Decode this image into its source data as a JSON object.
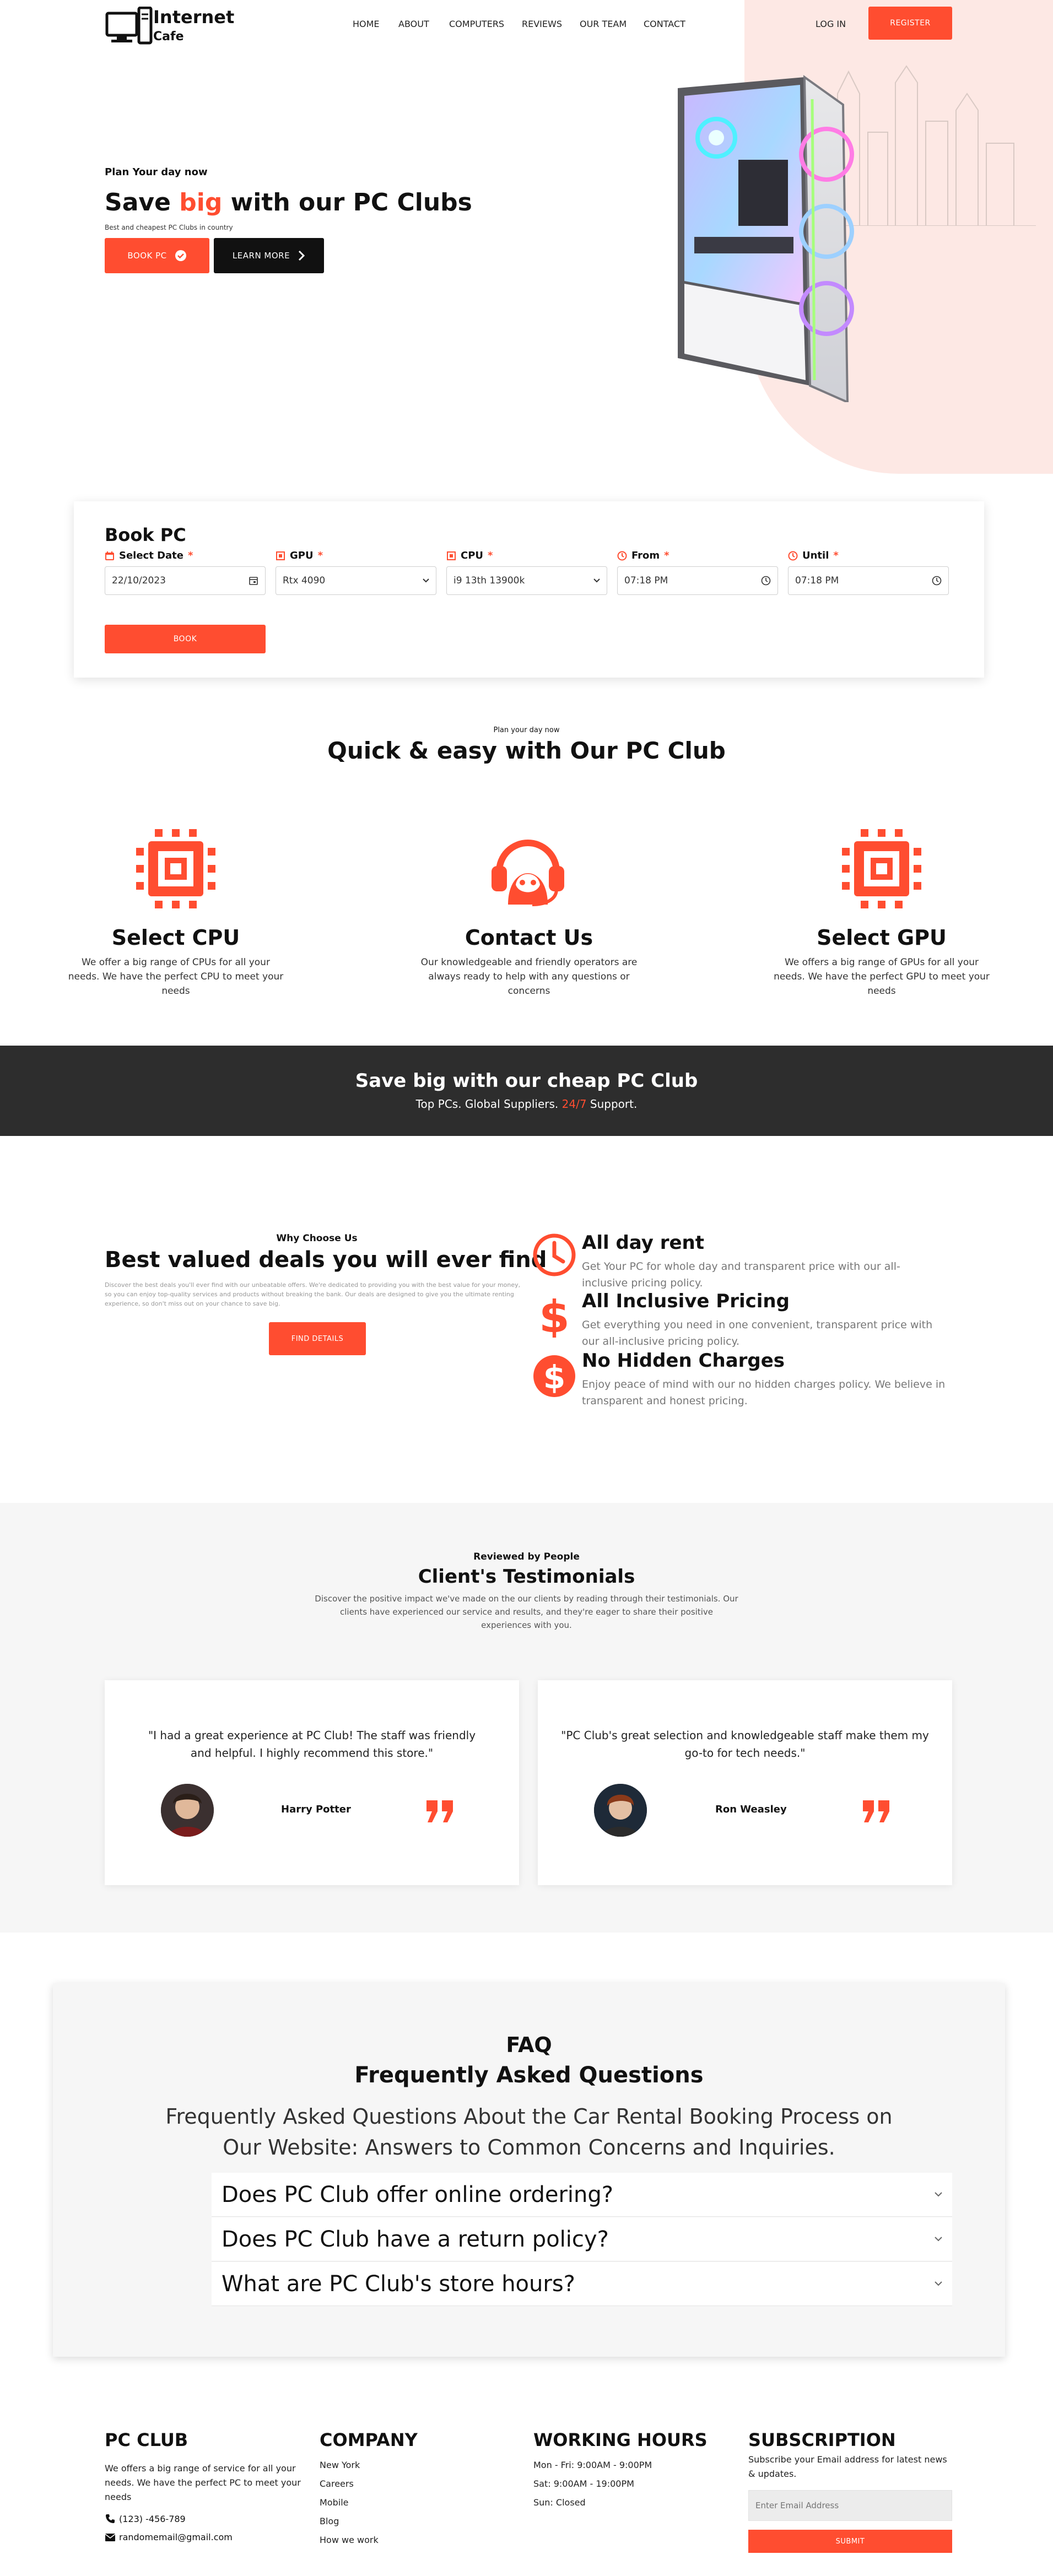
{
  "colors": {
    "accent": "#ff4d30",
    "dark_banner": "#2d2d2d",
    "hero_blob": "#fde8e4",
    "light_bg": "#f6f6f6"
  },
  "brand": {
    "line1": "Internet",
    "line2": "Cafe",
    "icon": "computer-icon"
  },
  "nav": {
    "links": [
      "HOME",
      "ABOUT",
      "COMPUTERS",
      "REVIEWS",
      "OUR TEAM",
      "CONTACT"
    ],
    "login": "LOG IN",
    "register": "REGISTER"
  },
  "hero": {
    "kicker": "Plan Your day now",
    "title_before": "Save ",
    "title_accent": "big",
    "title_after": " with our PC Clubs",
    "subtitle": "Best and cheapest PC Clubs in country",
    "book_button": "BOOK PC",
    "learn_button": "LEARN MORE"
  },
  "booking": {
    "title": "Book PC",
    "fields": [
      {
        "label": "Select Date",
        "value": "22/10/2023",
        "icon": "calendar-icon",
        "control": "calendar-icon"
      },
      {
        "label": "GPU",
        "value": "Rtx 4090",
        "icon": "chip-icon",
        "control": "chevron-down-icon"
      },
      {
        "label": "CPU",
        "value": "i9 13th 13900k",
        "icon": "chip-icon",
        "control": "chevron-down-icon"
      },
      {
        "label": "From",
        "value": "07:18 PM",
        "icon": "clock-icon",
        "control": "clock-icon"
      },
      {
        "label": "Until",
        "value": "07:18 PM",
        "icon": "clock-icon",
        "control": "clock-icon"
      }
    ],
    "required_mark": "*",
    "submit": "BOOK"
  },
  "features": {
    "kicker": "Plan your day now",
    "title": "Quick & easy with Our PC Club",
    "items": [
      {
        "title": "Select CPU",
        "desc": "We offer a big range of CPUs for all your needs. We have the perfect CPU to meet your needs",
        "icon": "cpu-icon"
      },
      {
        "title": "Contact Us",
        "desc": "Our knowledgeable and friendly operators are always ready to help with any questions or concerns",
        "icon": "headset-operator-icon"
      },
      {
        "title": "Select GPU",
        "desc": "We offers a big range of GPUs for all your needs. We have the perfect GPU to meet your needs",
        "icon": "cpu-icon"
      }
    ]
  },
  "banner": {
    "title": "Save big with our cheap PC Club",
    "sub_before": "Top PCs. Global Suppliers. ",
    "sub_accent": "24/7",
    "sub_after": " Support."
  },
  "why": {
    "kicker": "Why Choose Us",
    "title": "Best valued deals you will ever find",
    "desc": "Discover the best deals you'll ever find with our unbeatable offers. We're dedicated to providing you with the best value for your money, so you can enjoy top-quality services and products without breaking the bank. Our deals are designed to give you the ultimate renting experience, so don't miss out on your chance to save big.",
    "button": "FIND DETAILS",
    "items": [
      {
        "title": "All day rent",
        "desc": "Get Your PC for whole day and transparent price with our all-inclusive pricing policy.",
        "icon": "clock-icon"
      },
      {
        "title": "All Inclusive Pricing",
        "desc": "Get everything you need in one convenient, transparent price with our all-inclusive pricing policy.",
        "icon": "dollar-icon"
      },
      {
        "title": "No Hidden Charges",
        "desc": "Enjoy peace of mind with our no hidden charges policy. We believe in transparent and honest pricing.",
        "icon": "dollar-circle-icon"
      }
    ]
  },
  "testimonials": {
    "kicker": "Reviewed by People",
    "title": "Client's Testimonials",
    "desc": "Discover the positive impact we've made on the our clients by reading through their testimonials. Our clients have experienced our service and results, and they're eager to share their positive experiences with you.",
    "items": [
      {
        "quote": "\"I had a great experience at PC Club! The staff was friendly and helpful. I highly recommend this store.\"",
        "name": "Harry Potter"
      },
      {
        "quote": "\"PC Club's great selection and knowledgeable staff make them my go-to for tech needs.\"",
        "name": "Ron Weasley"
      }
    ]
  },
  "faq": {
    "kicker": "FAQ",
    "title": "Frequently Asked Questions",
    "desc": "Frequently Asked Questions About the Car Rental Booking Process on Our Website: Answers to Common Concerns and Inquiries.",
    "items": [
      "Does PC Club offer online ordering?",
      "Does PC Club have a return policy?",
      "What are PC Club's store hours?"
    ]
  },
  "footer": {
    "about": {
      "title": "PC CLUB",
      "text": "We offers a big range of service for all your needs. We have the perfect PC to meet your needs",
      "phone": "(123) -456-789",
      "email": "randomemail@gmail.com"
    },
    "company": {
      "title": "COMPANY",
      "links": [
        "New York",
        "Careers",
        "Mobile",
        "Blog",
        "How we work"
      ]
    },
    "hours": {
      "title": "WORKING HOURS",
      "lines": [
        "Mon - Fri: 9:00AM - 9:00PM",
        "Sat: 9:00AM - 19:00PM",
        "Sun: Closed"
      ]
    },
    "subscription": {
      "title": "SUBSCRIPTION",
      "text": "Subscribe your Email address for latest news & updates.",
      "placeholder": "Enter Email Address",
      "button": "SUBMIT"
    }
  }
}
